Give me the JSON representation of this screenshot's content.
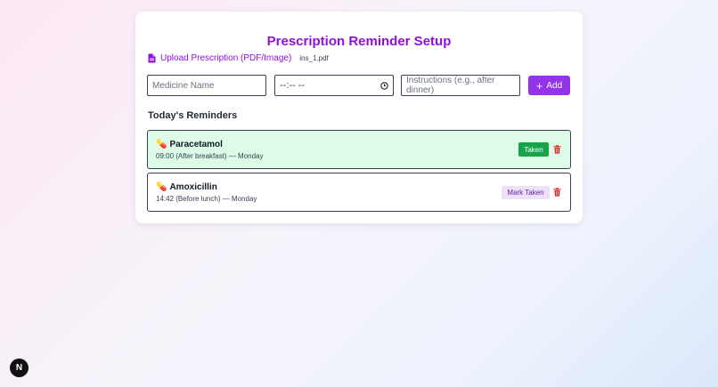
{
  "page": {
    "title": "Prescription Reminder Setup"
  },
  "upload": {
    "label": "Upload Prescription (PDF/Image)",
    "file_name": "ins_1.pdf",
    "icon": "document-icon"
  },
  "form": {
    "medicine_placeholder": "Medicine Name",
    "time_value": "--:-- --",
    "instructions_placeholder": "Instructions (e.g., after dinner)",
    "add_label": "Add"
  },
  "reminders_title": "Today's Reminders",
  "reminders": [
    {
      "name": "Paracetamol",
      "detail": "09:00 (After breakfast) — Monday",
      "action_label": "Taken",
      "status": "taken"
    },
    {
      "name": "Amoxicillin",
      "detail": "14:42 (Before lunch) — Monday",
      "action_label": "Mark Taken",
      "status": "pending"
    }
  ],
  "fab": {
    "label": "N"
  },
  "colors": {
    "accent": "#9010d8",
    "add_button": "#9333ea",
    "taken_green": "#16a34a",
    "taken_row_bg": "#dcfce7",
    "delete_red": "#dc2626"
  }
}
